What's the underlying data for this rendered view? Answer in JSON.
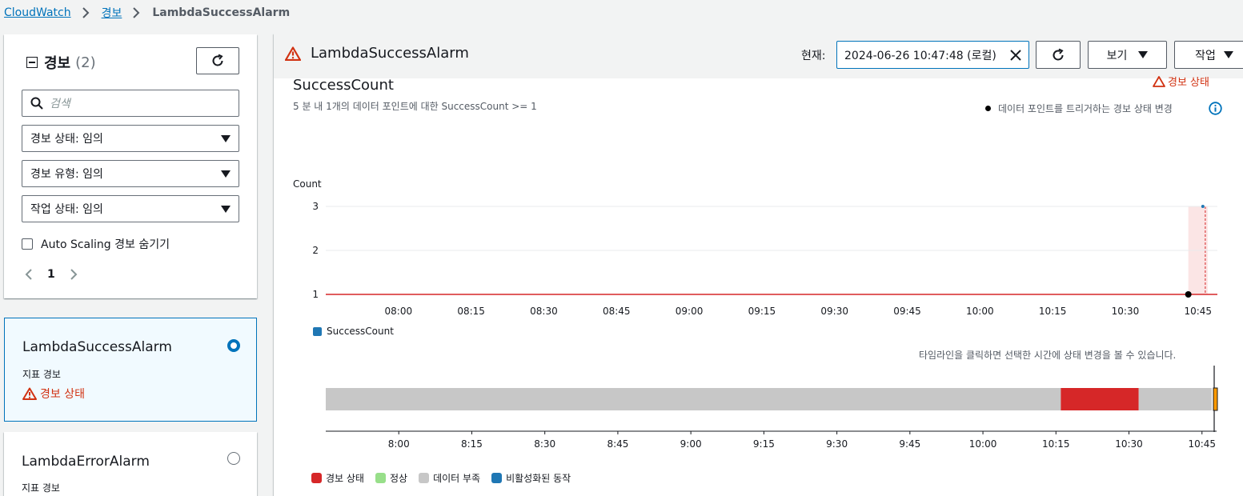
{
  "breadcrumb": {
    "root": "CloudWatch",
    "section": "경보",
    "current": "LambdaSuccessAlarm"
  },
  "left_panel": {
    "title": "경보",
    "count": "(2)",
    "search_placeholder": "검색",
    "filters": [
      "경보 상태: 임의",
      "경보 유형: 임의",
      "작업 상태: 임의"
    ],
    "hide_autoscaling_label": "Auto Scaling 경보 숨기기",
    "page": "1"
  },
  "alarms": [
    {
      "name": "LambdaSuccessAlarm",
      "type": "지표 경보",
      "state": "경보 상태",
      "selected": true
    },
    {
      "name": "LambdaErrorAlarm",
      "type": "지표 경보",
      "selected": false
    }
  ],
  "detail": {
    "alarm_name": "LambdaSuccessAlarm",
    "current_label": "현재:",
    "current_time": "2024-06-26 10:47:48 (로컬)",
    "view_label": "보기",
    "actions_label": "작업",
    "metric_title": "SuccessCount",
    "condition": "5 분 내 1개의 데이터 포인트에 대한 SuccessCount >= 1",
    "state_corner": "경보 상태",
    "legend_trigger": "데이터 포인트를 트리거하는 경보 상태 변경",
    "timeline_hint": "타임라인을 클릭하면 선택한 시간에 상태 변경을 볼 수 있습니다."
  },
  "colors": {
    "accent": "#0073bb",
    "alarm": "#d13212",
    "alarm_fill": "#d62728",
    "ok": "#98df8a",
    "insufficient": "#c7c7c7",
    "disabled": "#1f77b4",
    "metric_line": "#d62728",
    "alarm_region": "#fbe5e5"
  },
  "chart_data": {
    "type": "line",
    "ylabel": "Count",
    "ylim": [
      1,
      3
    ],
    "yticks": [
      3,
      2,
      1
    ],
    "xticks": [
      "08:00",
      "08:15",
      "08:30",
      "08:45",
      "09:00",
      "09:15",
      "09:30",
      "09:45",
      "10:00",
      "10:15",
      "10:30",
      "10:45"
    ],
    "series": [
      {
        "name": "SuccessCount",
        "color": "#1f77b4",
        "points": [
          {
            "x": "10:46",
            "y": 3
          }
        ]
      }
    ],
    "threshold_line": 1,
    "alarm_region": [
      "10:43",
      "10:47"
    ],
    "trigger_points": [
      {
        "x": "10:43",
        "y": 1
      }
    ]
  },
  "timeline": {
    "xticks": [
      "8:00",
      "8:15",
      "8:30",
      "8:45",
      "9:00",
      "9:15",
      "9:30",
      "9:45",
      "10:00",
      "10:15",
      "10:30",
      "10:45"
    ],
    "segments": [
      {
        "state": "insufficient",
        "from": "07:45",
        "to": "10:16"
      },
      {
        "state": "alarm",
        "from": "10:16",
        "to": "10:32"
      },
      {
        "state": "insufficient",
        "from": "10:32",
        "to": "10:47"
      }
    ],
    "legend": [
      {
        "label": "경보 상태",
        "color": "#d62728"
      },
      {
        "label": "정상",
        "color": "#98df8a"
      },
      {
        "label": "데이터 부족",
        "color": "#c7c7c7"
      },
      {
        "label": "비활성화된 동작",
        "color": "#1f77b4"
      }
    ]
  }
}
